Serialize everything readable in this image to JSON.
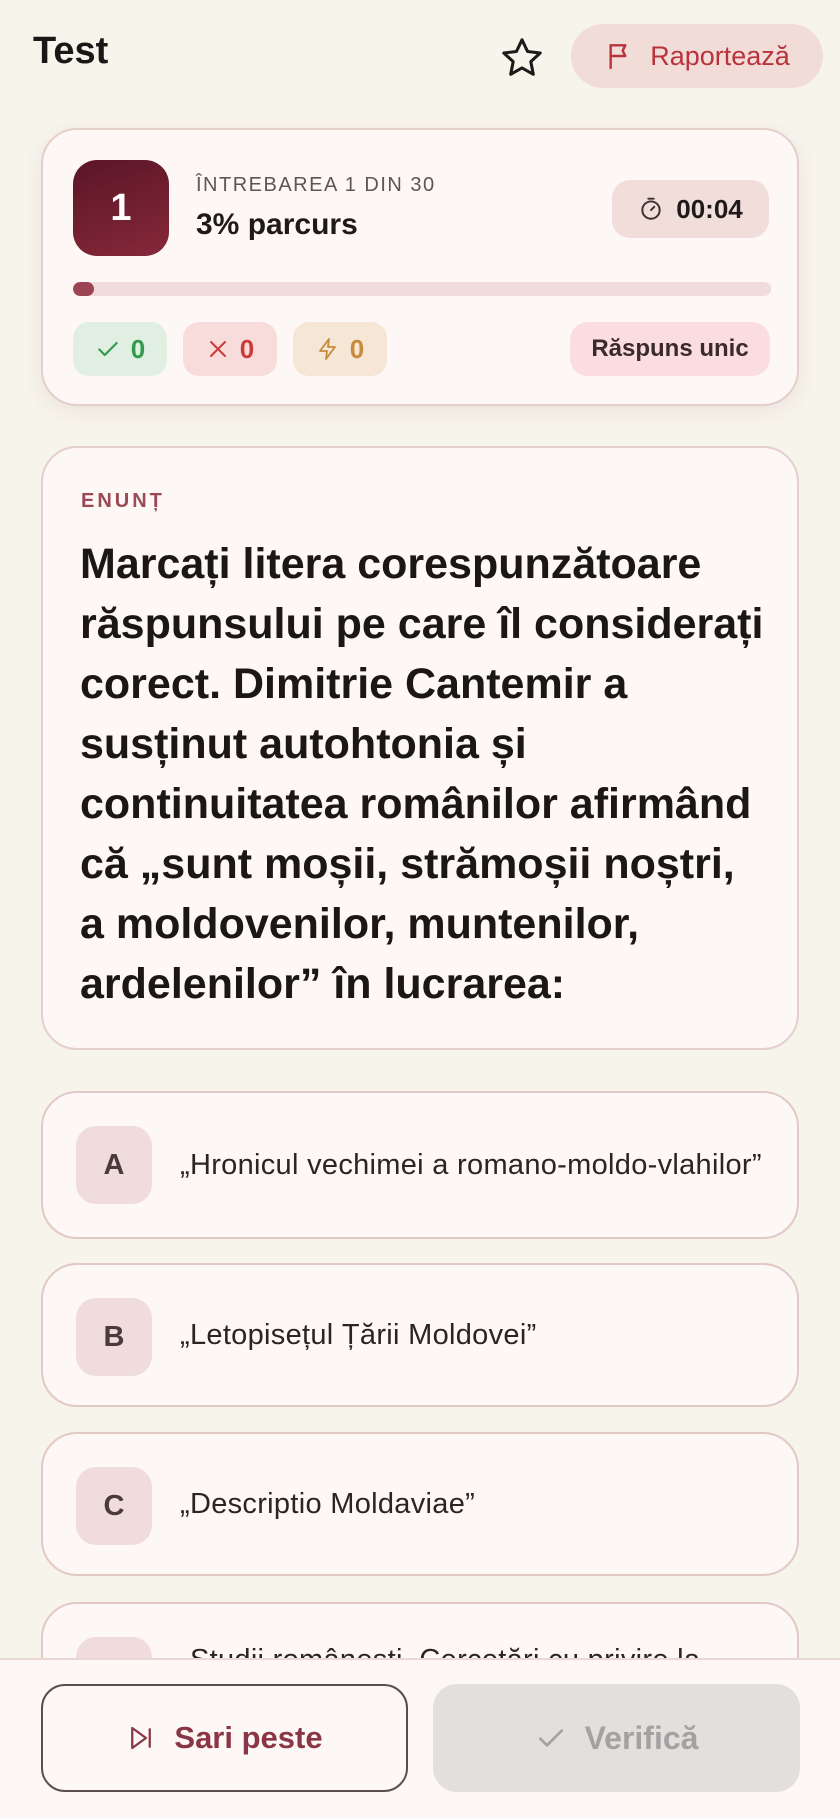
{
  "header": {
    "title": "Test",
    "report_label": "Raportează"
  },
  "progress": {
    "question_number": "1",
    "question_of": "ÎNTREBAREA 1 DIN 30",
    "percent_label": "3% parcurs",
    "percent_value": 0.03,
    "timer": "00:04",
    "correct_count": "0",
    "wrong_count": "0",
    "skipped_count": "0",
    "mode": "Răspuns unic"
  },
  "statement": {
    "label": "ENUNȚ",
    "text": "Marcați litera corespunzătoare răspunsului pe care îl considerați corect. Dimitrie Cantemir a susținut autohtonia și continuitatea românilor afirmând că „sunt moșii, strămoșii noștri, a moldovenilor, muntenilor, ardelenilor” în lucrarea:"
  },
  "options": [
    {
      "letter": "A",
      "text": "„Hronicul vechimei a romano-moldo-vlahilor”"
    },
    {
      "letter": "B",
      "text": "„Letopisețul Țării Moldovei”"
    },
    {
      "letter": "C",
      "text": "„Descriptio Moldaviae”"
    },
    {
      "letter": "D",
      "text": "„Studii românești. Cercetări cu privire la"
    }
  ],
  "footer": {
    "skip_label": "Sari peste",
    "verify_label": "Verifică"
  },
  "colors": {
    "accent": "#8a3644",
    "background": "#f7f4ec",
    "correct": "#2f9b4b",
    "wrong": "#cc3a3a",
    "skipped": "#c88b39"
  },
  "icons": {
    "favorite": "star-icon",
    "report": "flag-icon",
    "timer": "timer-icon",
    "correct": "check-icon",
    "wrong": "x-icon",
    "skipped": "lightning-icon",
    "skip": "skip-forward-icon",
    "verify": "check-icon"
  }
}
